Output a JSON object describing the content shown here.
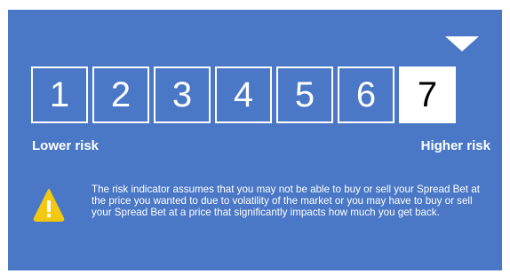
{
  "risk_indicator": {
    "levels": [
      "1",
      "2",
      "3",
      "4",
      "5",
      "6",
      "7"
    ],
    "selected_level": 7,
    "low_label": "Lower risk",
    "high_label": "Higher risk"
  },
  "warning": {
    "icon": "warning-triangle-icon",
    "message": "The risk indicator assumes that you may not be able to buy or sell your Spread Bet at the price you wanted to  due to volatility of the market or you may have to buy or sell your Spread Bet at a price that significantly impacts how much you get back."
  },
  "colors": {
    "background": "#4a78c6",
    "warning": "#f2c811"
  }
}
